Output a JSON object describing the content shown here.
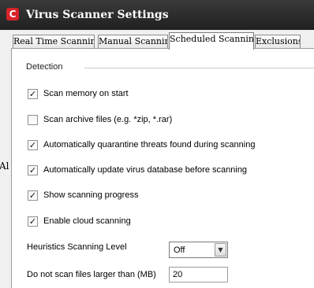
{
  "window": {
    "title": "Virus Scanner Settings",
    "icon": "comodo-c-logo",
    "icon_char": "C"
  },
  "tabs": [
    {
      "label": "Real Time Scanning",
      "active": false
    },
    {
      "label": "Manual Scanning",
      "active": false
    },
    {
      "label": "Scheduled Scanning",
      "active": true
    },
    {
      "label": "Exclusions",
      "active": false
    }
  ],
  "background_sliver_text": "Al",
  "detection": {
    "group_title": "Detection",
    "options": [
      {
        "label": "Scan memory on start",
        "checked": true
      },
      {
        "label": "Scan archive files (e.g. *zip, *.rar)",
        "checked": false
      },
      {
        "label": "Automatically quarantine threats found during scanning",
        "checked": true
      },
      {
        "label": "Automatically update virus database before scanning",
        "checked": true
      },
      {
        "label": "Show scanning progress",
        "checked": true
      },
      {
        "label": "Enable cloud scanning",
        "checked": true
      }
    ],
    "heuristics": {
      "label": "Heuristics Scanning Level",
      "value": "Off"
    },
    "max_file_size": {
      "label": "Do not scan files larger than (MB)",
      "value": "20"
    }
  }
}
